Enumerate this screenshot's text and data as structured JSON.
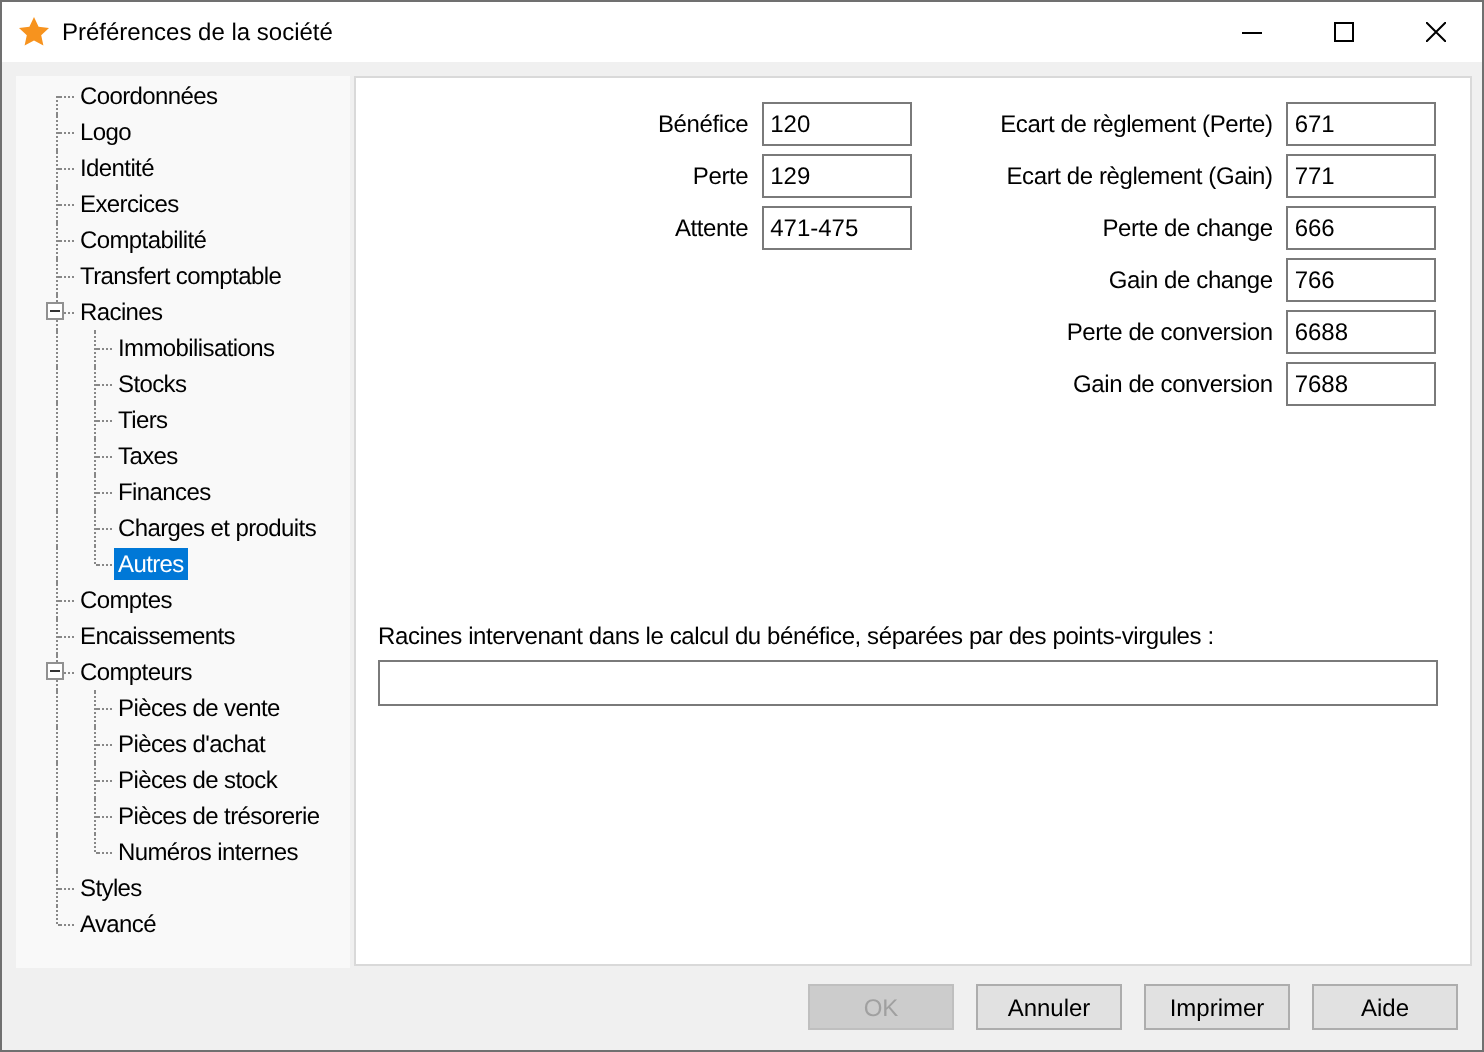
{
  "window": {
    "title": "Préférences de la société"
  },
  "tree": [
    {
      "label": "Coordonnées",
      "selected": false
    },
    {
      "label": "Logo",
      "selected": false
    },
    {
      "label": "Identité",
      "selected": false
    },
    {
      "label": "Exercices",
      "selected": false
    },
    {
      "label": "Comptabilité",
      "selected": false
    },
    {
      "label": "Transfert comptable",
      "selected": false
    },
    {
      "label": "Racines",
      "selected": false,
      "expanded": true,
      "children": [
        {
          "label": "Immobilisations",
          "selected": false
        },
        {
          "label": "Stocks",
          "selected": false
        },
        {
          "label": "Tiers",
          "selected": false
        },
        {
          "label": "Taxes",
          "selected": false
        },
        {
          "label": "Finances",
          "selected": false
        },
        {
          "label": "Charges et produits",
          "selected": false
        },
        {
          "label": "Autres",
          "selected": true
        }
      ]
    },
    {
      "label": "Comptes",
      "selected": false
    },
    {
      "label": "Encaissements",
      "selected": false
    },
    {
      "label": "Compteurs",
      "selected": false,
      "expanded": true,
      "children": [
        {
          "label": "Pièces de vente",
          "selected": false
        },
        {
          "label": "Pièces d'achat",
          "selected": false
        },
        {
          "label": "Pièces de stock",
          "selected": false
        },
        {
          "label": "Pièces de trésorerie",
          "selected": false
        },
        {
          "label": "Numéros internes",
          "selected": false
        }
      ]
    },
    {
      "label": "Styles",
      "selected": false
    },
    {
      "label": "Avancé",
      "selected": false
    }
  ],
  "left_fields": [
    {
      "label": "Bénéfice",
      "value": "120"
    },
    {
      "label": "Perte",
      "value": "129"
    },
    {
      "label": "Attente",
      "value": "471-475"
    }
  ],
  "right_fields": [
    {
      "label": "Ecart de règlement (Perte)",
      "value": "671"
    },
    {
      "label": "Ecart de règlement (Gain)",
      "value": "771"
    },
    {
      "label": "Perte de change",
      "value": "666"
    },
    {
      "label": "Gain de change",
      "value": "766"
    },
    {
      "label": "Perte de conversion",
      "value": "6688"
    },
    {
      "label": "Gain de conversion",
      "value": "7688"
    }
  ],
  "profit_roots": {
    "label": "Racines intervenant dans le calcul du bénéfice, séparées par des points-virgules :"
  },
  "buttons": [
    {
      "label": "OK",
      "disabled": true
    },
    {
      "label": "Annuler",
      "disabled": false
    },
    {
      "label": "Imprimer",
      "disabled": false
    },
    {
      "label": "Aide",
      "disabled": false
    }
  ]
}
